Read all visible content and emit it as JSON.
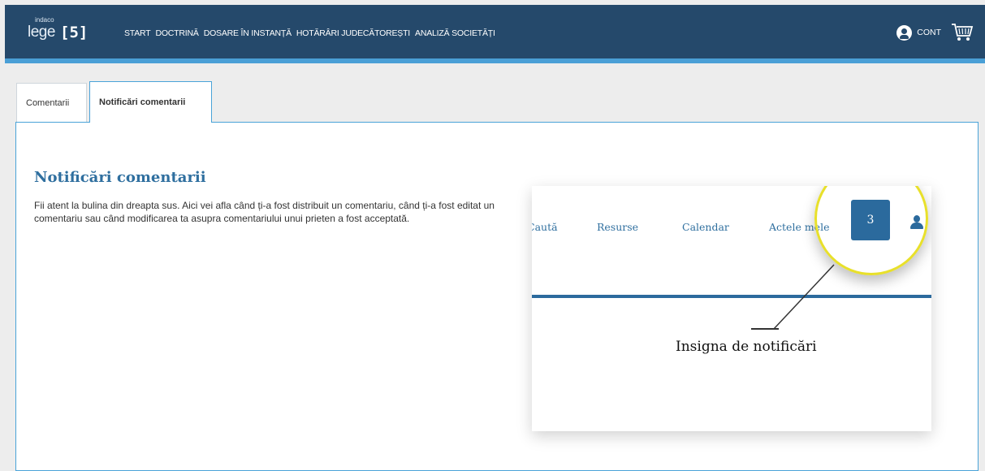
{
  "header": {
    "logo_small": "indaco",
    "logo_text": "lege",
    "logo_num": "[5]",
    "nav": [
      "START",
      "DOCTRINĂ",
      "DOSARE ÎN INSTANȚĂ",
      "HOTĂRÂRI JUDECĂTOREȘTI",
      "ANALIZĂ SOCIETĂȚI"
    ],
    "account_label": "CONT",
    "icons": [
      "user-icon",
      "cart-icon"
    ]
  },
  "tabs": [
    {
      "label": "Comentarii",
      "active": false
    },
    {
      "label": "Notificări comentarii",
      "active": true
    }
  ],
  "content": {
    "title": "Notificări comentarii",
    "description": "Fii atent la bulina din dreapta sus. Aici vei afla când ți-a fost distribuit un comentariu, când ți-a fost editat un comentariu sau când modificarea ta asupra comentariului unui prieten a fost acceptată."
  },
  "illustration": {
    "menu": [
      "Caută",
      "Resurse",
      "Calendar",
      "Actele mele"
    ],
    "badge_count": "3",
    "callout": "Insigna de notificări"
  },
  "colors": {
    "navbar": "#25496b",
    "stripe": "#4a9fd6",
    "accent": "#2f6f9f",
    "highlight_ring": "#e8e02b"
  }
}
